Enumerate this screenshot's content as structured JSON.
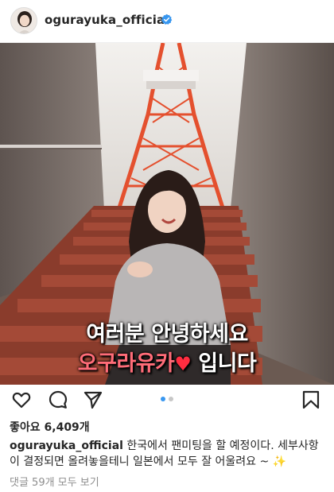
{
  "post": {
    "username": "ogurayuka_official",
    "verified": true
  },
  "media": {
    "overlay_line1": "여러분 안녕하세요",
    "overlay_name": "오구라유카",
    "overlay_heart": "♥",
    "overlay_suffix": " 입니다"
  },
  "carousel": {
    "count": 2,
    "active_index": 0,
    "active_color": "#3897f0",
    "inactive_color": "#c7c7c7"
  },
  "actions": {
    "icons": [
      "heart-outline-icon",
      "comment-icon",
      "share-icon",
      "bookmark-icon"
    ]
  },
  "likes": {
    "text": "좋아요 6,409개"
  },
  "caption": {
    "username": "ogurayuka_official",
    "text": " 한국에서 팬미팅을 할 예정이다. 세부사항이 결정되면 올려놓을테니 일본에서 모두 잘 어울려요 ~ ✨"
  },
  "comments": {
    "link_text": "댓글 59개 모두 보기"
  },
  "colors": {
    "accent": "#3897f0",
    "text": "#262626",
    "muted": "#8e8e8e",
    "overlay_pink": "#ff6c78",
    "heart": "#ff2d40"
  }
}
